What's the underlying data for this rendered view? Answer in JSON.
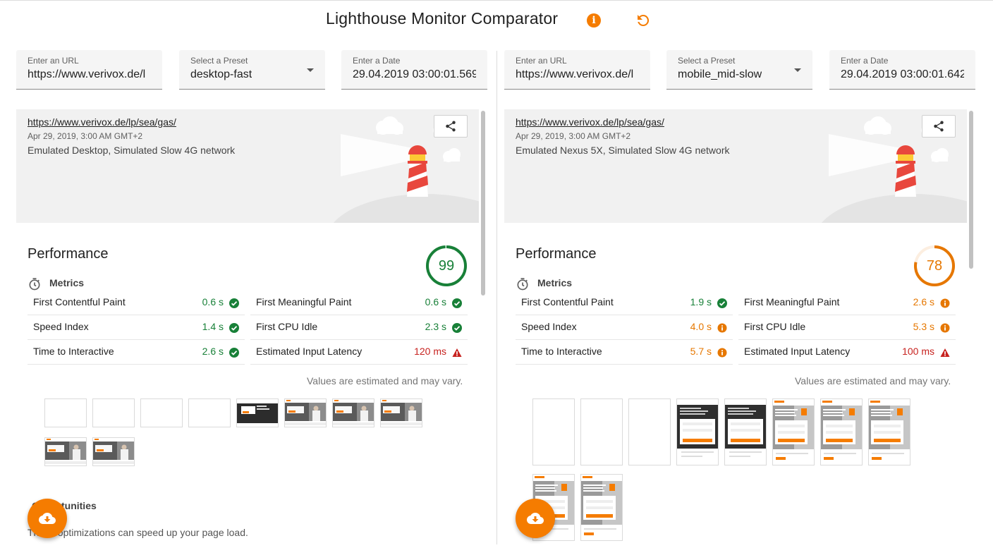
{
  "app": {
    "title": "Lighthouse Monitor Comparator",
    "accent_color": "#f57c00"
  },
  "icons": {
    "info": "info-icon",
    "refresh": "refresh-icon",
    "share": "share-icon",
    "download": "cloud-download-icon",
    "metrics": "stopwatch-icon"
  },
  "left": {
    "url_field": {
      "label": "Enter an URL",
      "value": "https://www.verivox.de/l"
    },
    "preset_field": {
      "label": "Select a Preset",
      "value": "desktop-fast"
    },
    "date_field": {
      "label": "Enter a Date",
      "value": "29.04.2019 03:00:01.569"
    },
    "report": {
      "url": "https://www.verivox.de/lp/sea/gas/",
      "date": "Apr 29, 2019, 3:00 AM GMT+2",
      "env": "Emulated Desktop, Simulated Slow 4G network",
      "perf_title": "Performance",
      "score": "99",
      "score_fraction": 0.99,
      "score_color": "#188038",
      "metrics_label": "Metrics",
      "metrics": [
        {
          "name": "First Contentful Paint",
          "value": "0.6 s",
          "status": "pass"
        },
        {
          "name": "First Meaningful Paint",
          "value": "0.6 s",
          "status": "pass"
        },
        {
          "name": "Speed Index",
          "value": "1.4 s",
          "status": "pass"
        },
        {
          "name": "First CPU Idle",
          "value": "2.3 s",
          "status": "pass"
        },
        {
          "name": "Time to Interactive",
          "value": "2.6 s",
          "status": "pass"
        },
        {
          "name": "Estimated Input Latency",
          "value": "120 ms",
          "status": "fail"
        }
      ],
      "note": "Values are estimated and may vary.",
      "opportunities_label": "Opportunities",
      "opportunities_desc": "These optimizations can speed up your page load."
    }
  },
  "right": {
    "url_field": {
      "label": "Enter an URL",
      "value": "https://www.verivox.de/l"
    },
    "preset_field": {
      "label": "Select a Preset",
      "value": "mobile_mid-slow"
    },
    "date_field": {
      "label": "Enter a Date",
      "value": "29.04.2019 03:00:01.642"
    },
    "report": {
      "url": "https://www.verivox.de/lp/sea/gas/",
      "date": "Apr 29, 2019, 3:00 AM GMT+2",
      "env": "Emulated Nexus 5X, Simulated Slow 4G network",
      "perf_title": "Performance",
      "score": "78",
      "score_fraction": 0.78,
      "score_color": "#e67700",
      "metrics_label": "Metrics",
      "metrics": [
        {
          "name": "First Contentful Paint",
          "value": "1.9 s",
          "status": "pass"
        },
        {
          "name": "First Meaningful Paint",
          "value": "2.6 s",
          "status": "average"
        },
        {
          "name": "Speed Index",
          "value": "4.0 s",
          "status": "average"
        },
        {
          "name": "First CPU Idle",
          "value": "5.3 s",
          "status": "average"
        },
        {
          "name": "Time to Interactive",
          "value": "5.7 s",
          "status": "average"
        },
        {
          "name": "Estimated Input Latency",
          "value": "100 ms",
          "status": "fail"
        }
      ],
      "note": "Values are estimated and may vary."
    }
  },
  "status_colors": {
    "pass": "#188038",
    "average": "#e67700",
    "fail": "#c7221f"
  }
}
